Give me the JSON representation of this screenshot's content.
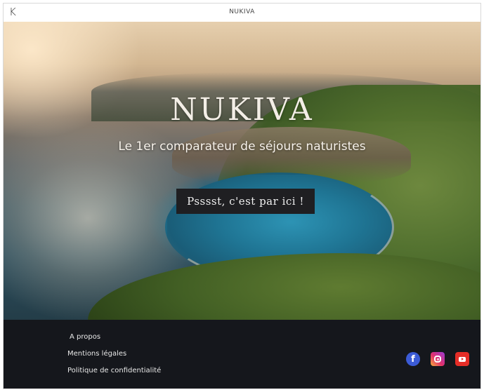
{
  "header": {
    "logo_letter": "K",
    "brand": "NUKIVA"
  },
  "hero": {
    "title": "NUKIVA",
    "subtitle": "Le 1er comparateur de séjours naturistes",
    "cta_label": "Psssst, c'est par ici !"
  },
  "footer": {
    "links": [
      {
        "label": "A propos"
      },
      {
        "label": "Mentions légales"
      },
      {
        "label": "Politique de confidentialité"
      }
    ],
    "social": [
      {
        "icon": "facebook-icon",
        "glyph": "f",
        "color": "#3b5bd6"
      },
      {
        "icon": "instagram-icon",
        "color": "#e1306c"
      },
      {
        "icon": "youtube-icon",
        "color": "#e52d27"
      }
    ]
  },
  "colors": {
    "footer_bg": "#15171c",
    "cta_bg": "#1f1f22",
    "title_text": "#f3eee6"
  }
}
